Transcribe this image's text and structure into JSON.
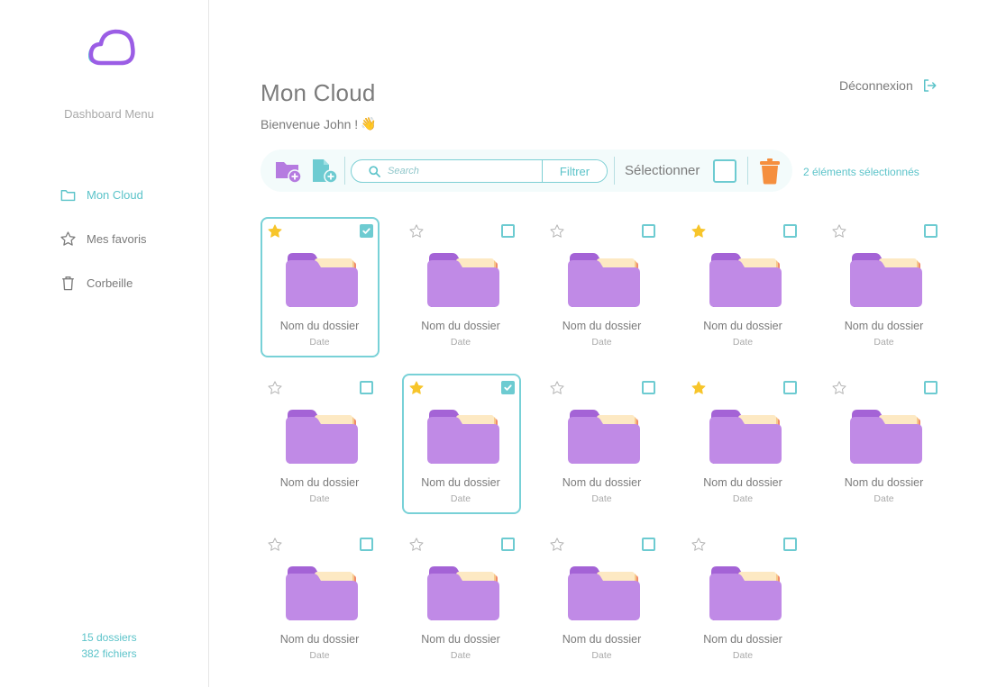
{
  "sidebar": {
    "menu_title": "Dashboard Menu",
    "items": [
      {
        "label": "Mon Cloud",
        "icon": "folder-icon",
        "active": true
      },
      {
        "label": "Mes favoris",
        "icon": "star-icon",
        "active": false
      },
      {
        "label": "Corbeille",
        "icon": "trash-icon",
        "active": false
      }
    ],
    "stats": {
      "folders": "15 dossiers",
      "files": "382 fichiers"
    }
  },
  "header": {
    "title": "Mon Cloud",
    "welcome": "Bienvenue John !",
    "welcome_emoji": "👋",
    "logout_label": "Déconnexion"
  },
  "toolbar": {
    "search_placeholder": "Search",
    "filter_label": "Filtrer",
    "select_label": "Sélectionner",
    "selected_count": "2 éléments sélectionnés"
  },
  "colors": {
    "accent": "#5bc3c9",
    "star_active": "#f7c52b",
    "folder": "#b57be0",
    "delete": "#f58f3e"
  },
  "folders": [
    {
      "name": "Nom du dossier",
      "date": "Date",
      "favorite": true,
      "selected": true
    },
    {
      "name": "Nom du dossier",
      "date": "Date",
      "favorite": false,
      "selected": false
    },
    {
      "name": "Nom du dossier",
      "date": "Date",
      "favorite": false,
      "selected": false
    },
    {
      "name": "Nom du dossier",
      "date": "Date",
      "favorite": true,
      "selected": false
    },
    {
      "name": "Nom du dossier",
      "date": "Date",
      "favorite": false,
      "selected": false
    },
    {
      "name": "Nom du dossier",
      "date": "Date",
      "favorite": false,
      "selected": false
    },
    {
      "name": "Nom du dossier",
      "date": "Date",
      "favorite": true,
      "selected": true
    },
    {
      "name": "Nom du dossier",
      "date": "Date",
      "favorite": false,
      "selected": false
    },
    {
      "name": "Nom du dossier",
      "date": "Date",
      "favorite": true,
      "selected": false
    },
    {
      "name": "Nom du dossier",
      "date": "Date",
      "favorite": false,
      "selected": false
    },
    {
      "name": "Nom du dossier",
      "date": "Date",
      "favorite": false,
      "selected": false
    },
    {
      "name": "Nom du dossier",
      "date": "Date",
      "favorite": false,
      "selected": false
    },
    {
      "name": "Nom du dossier",
      "date": "Date",
      "favorite": false,
      "selected": false
    },
    {
      "name": "Nom du dossier",
      "date": "Date",
      "favorite": false,
      "selected": false
    }
  ]
}
